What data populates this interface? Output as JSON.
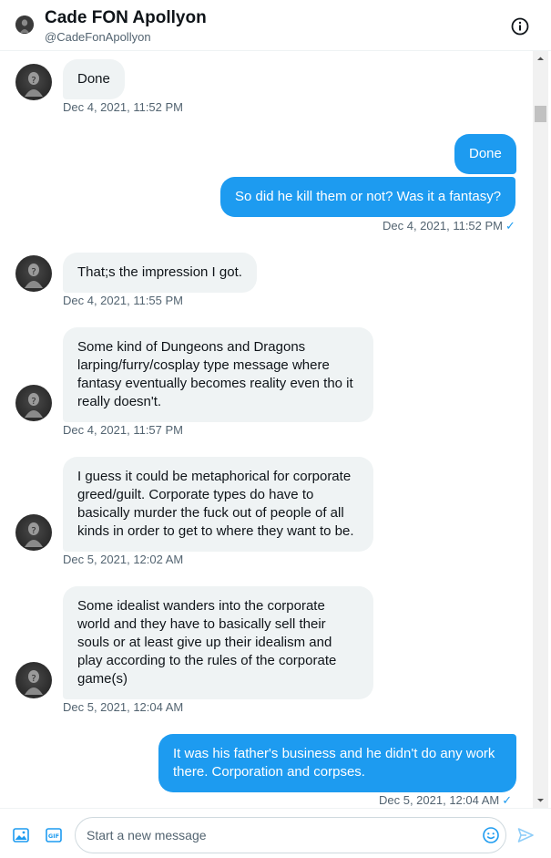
{
  "header": {
    "name": "Cade FON Apollyon",
    "handle": "@CadeFonApollyon",
    "info_icon": "info-icon"
  },
  "messages": [
    {
      "direction": "in",
      "text": "Done",
      "time": "Dec 4, 2021, 11:52 PM"
    },
    {
      "direction": "out",
      "text": "Done",
      "time": ""
    },
    {
      "direction": "out",
      "text": "So did he kill them or not? Was it a fantasy?",
      "time": "Dec 4, 2021, 11:52 PM"
    },
    {
      "direction": "in",
      "text": "That;s the impression I got.",
      "time": "Dec 4, 2021, 11:55 PM"
    },
    {
      "direction": "in",
      "text": "Some kind of Dungeons and Dragons larping/furry/cosplay type message where fantasy eventually becomes reality even tho it really doesn't.",
      "time": "Dec 4, 2021, 11:57 PM"
    },
    {
      "direction": "in",
      "text": "I guess it could be metaphorical for corporate greed/guilt. Corporate types do have to basically murder the fuck out of people of all kinds in order to get to where they want to be.",
      "time": "Dec 5, 2021, 12:02 AM"
    },
    {
      "direction": "in",
      "text": "Some idealist wanders into the corporate world and they have to basically sell their souls or at least give up their idealism and play according to the rules of the corporate game(s)",
      "time": "Dec 5, 2021, 12:04 AM"
    },
    {
      "direction": "out",
      "text": "It was his father's business and he didn't do any work there. Corporation  and corpses.",
      "time": "Dec 5, 2021, 12:04 AM"
    }
  ],
  "composer": {
    "placeholder": "Start a new message",
    "media_icon": "image-icon",
    "gif_icon": "gif-icon",
    "gif_label": "GIF",
    "emoji_icon": "emoji-icon",
    "send_icon": "send-icon"
  },
  "colors": {
    "accent": "#1d9bf0",
    "incoming_bubble": "#eff3f4",
    "muted_text": "#536471"
  }
}
